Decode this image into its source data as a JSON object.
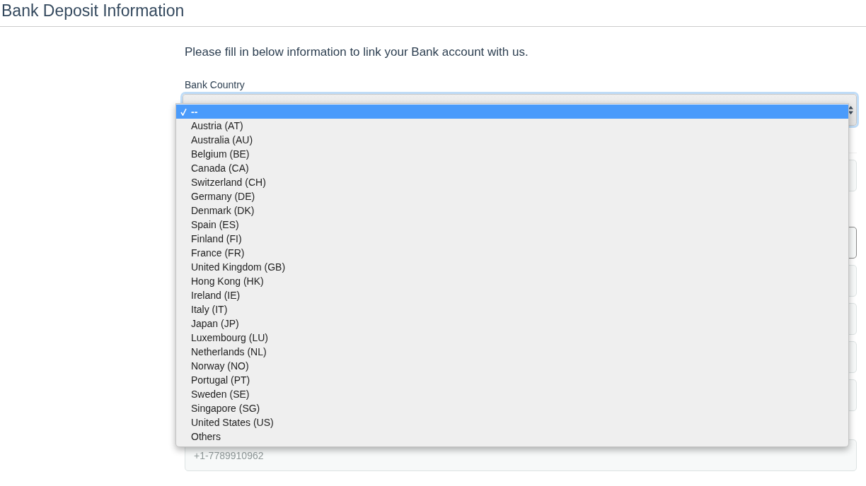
{
  "page_title": "Bank Deposit Information",
  "intro": "Please fill in below information to link your Bank account with us.",
  "bank_country": {
    "label": "Bank Country",
    "expanded": true,
    "options": [
      {
        "label": "--",
        "selected": true
      },
      {
        "label": "Austria (AT)",
        "selected": false
      },
      {
        "label": "Australia (AU)",
        "selected": false
      },
      {
        "label": "Belgium (BE)",
        "selected": false
      },
      {
        "label": "Canada (CA)",
        "selected": false
      },
      {
        "label": "Switzerland (CH)",
        "selected": false
      },
      {
        "label": "Germany (DE)",
        "selected": false
      },
      {
        "label": "Denmark (DK)",
        "selected": false
      },
      {
        "label": "Spain (ES)",
        "selected": false
      },
      {
        "label": "Finland (FI)",
        "selected": false
      },
      {
        "label": "France (FR)",
        "selected": false
      },
      {
        "label": "United Kingdom (GB)",
        "selected": false
      },
      {
        "label": "Hong Kong (HK)",
        "selected": false
      },
      {
        "label": "Ireland (IE)",
        "selected": false
      },
      {
        "label": "Italy (IT)",
        "selected": false
      },
      {
        "label": "Japan (JP)",
        "selected": false
      },
      {
        "label": "Luxembourg (LU)",
        "selected": false
      },
      {
        "label": "Netherlands (NL)",
        "selected": false
      },
      {
        "label": "Norway (NO)",
        "selected": false
      },
      {
        "label": "Portugal (PT)",
        "selected": false
      },
      {
        "label": "Sweden (SE)",
        "selected": false
      },
      {
        "label": "Singapore (SG)",
        "selected": false
      },
      {
        "label": "United States (US)",
        "selected": false
      },
      {
        "label": "Others",
        "selected": false
      }
    ]
  },
  "phone_field": {
    "placeholder": "+1-7789910962"
  }
}
